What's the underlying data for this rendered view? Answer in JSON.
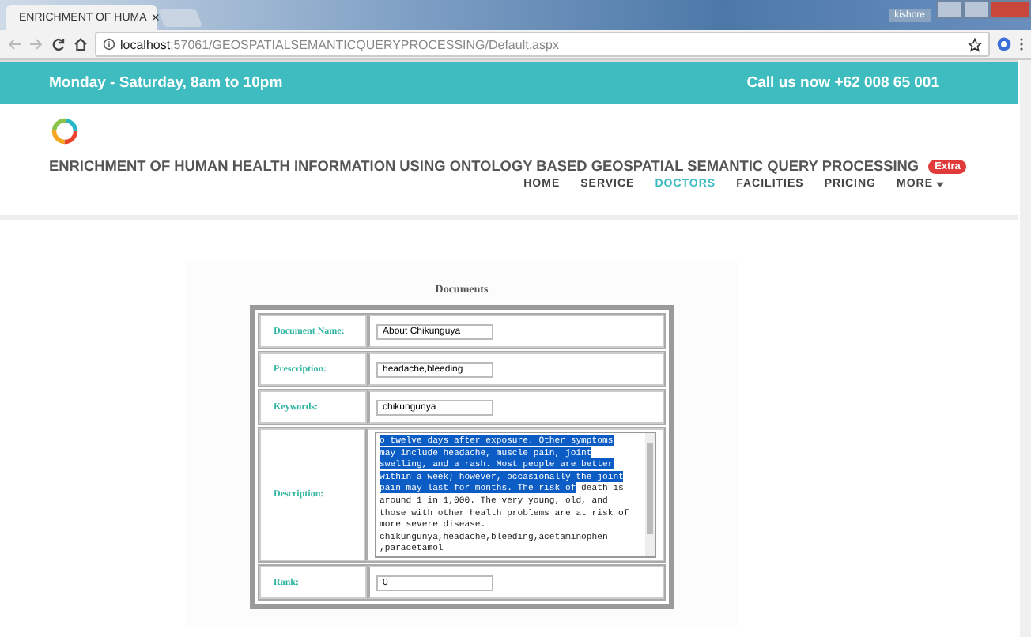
{
  "browser": {
    "tab_title": "ENRICHMENT OF HUMA",
    "close": "×",
    "user": "kishore",
    "url_host": "localhost",
    "url_rest": ":57061/GEOSPATIALSEMANTICQUERYPROCESSING/Default.aspx"
  },
  "topbar": {
    "hours": "Monday - Saturday, 8am to 10pm",
    "call": "Call us now +62 008 65 001"
  },
  "header": {
    "title": "ENRICHMENT OF HUMAN HEALTH INFORMATION USING ONTOLOGY BASED GEOSPATIAL SEMANTIC QUERY PROCESSING",
    "badge": "Extra"
  },
  "nav": [
    {
      "label": "HOME",
      "selected": false,
      "dropdown": false
    },
    {
      "label": "SERVICE",
      "selected": false,
      "dropdown": false
    },
    {
      "label": "DOCTORS",
      "selected": true,
      "dropdown": false
    },
    {
      "label": "FACILITIES",
      "selected": false,
      "dropdown": false
    },
    {
      "label": "PRICING",
      "selected": false,
      "dropdown": false
    },
    {
      "label": "MORE",
      "selected": false,
      "dropdown": true
    }
  ],
  "form": {
    "title": "Documents",
    "rows": [
      {
        "kind": "input",
        "label": "Document Name:",
        "value": "About Chikunguya"
      },
      {
        "kind": "input",
        "label": "Prescription:",
        "value": "headache,bleeding"
      },
      {
        "kind": "input",
        "label": "Keywords:",
        "value": "chikungunya"
      },
      {
        "kind": "textarea",
        "label": "Description:",
        "lines": [
          [
            {
              "text": "o twelve days after exposure. Other symptoms",
              "selected": true
            }
          ],
          [
            {
              "text": "may include headache, muscle pain, joint",
              "selected": true
            }
          ],
          [
            {
              "text": "swelling, and a rash. Most people are better",
              "selected": true
            }
          ],
          [
            {
              "text": "within a week; however, occasionally the joint",
              "selected": true
            }
          ],
          [
            {
              "text": "pain may last for months. The risk of",
              "selected": true
            },
            {
              "text": " death is",
              "selected": false
            }
          ],
          [
            {
              "text": "around 1 in 1,000. The very young, old, and",
              "selected": false
            }
          ],
          [
            {
              "text": "those with other health problems are at risk of",
              "selected": false
            }
          ],
          [
            {
              "text": "more severe disease.",
              "selected": false
            }
          ],
          [
            {
              "text": "chikungunya,headache,bleeding,acetaminophen",
              "selected": false
            }
          ],
          [
            {
              "text": ",paracetamol",
              "selected": false
            }
          ]
        ]
      },
      {
        "kind": "input",
        "label": "Rank:",
        "value": "0"
      }
    ]
  }
}
